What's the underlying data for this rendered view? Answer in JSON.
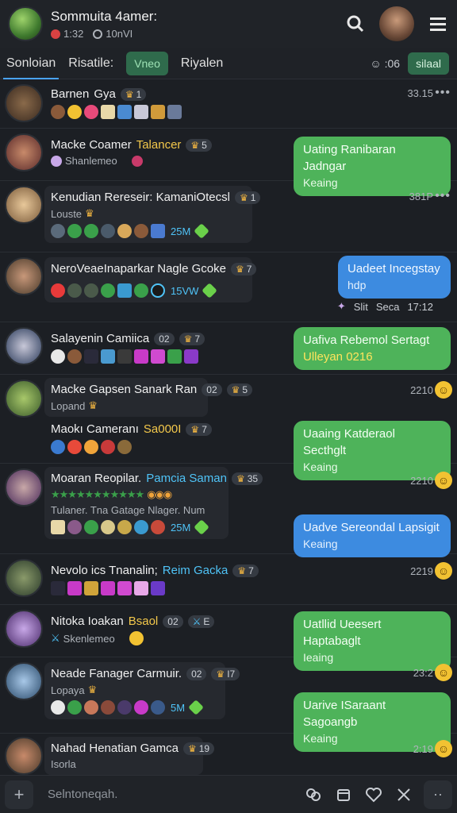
{
  "header": {
    "title": "Sommuita 4amer:",
    "status_count": "1:32",
    "status_time": "10nVI",
    "icons": [
      "search-icon",
      "user-avatar",
      "menu-icon"
    ]
  },
  "tabs": {
    "items": [
      "Sonloian",
      "Risatile:",
      "Vneo",
      "Riyalen"
    ],
    "counter": ":06",
    "action": "silaal"
  },
  "chats": [
    {
      "name": "Barnen",
      "name2": "Gya",
      "badge": "1",
      "time": "33.15",
      "dots": "•••"
    },
    {
      "name": "Macke Coamer",
      "name_hl": "Talancer",
      "badge": "5",
      "sub": "Shanlemeo",
      "reply": "Uating Ranibaran Jadngar",
      "reply_sub": "Keaing"
    },
    {
      "name": "Kenudian Rereseir: KamaniOtecsl",
      "badge": "1",
      "sub": "Louste",
      "stat": "25M",
      "time": "381P",
      "dots": "•••"
    },
    {
      "name": "NeroVeaeInaparkar Nagle Gcoke",
      "badge": "7",
      "stat": "15VW",
      "reply": "Uadeet Incegstay",
      "reply_sub": "hdp",
      "meta1": "Slit",
      "meta2": "Seca",
      "meta3": "17:12"
    },
    {
      "name": "Salayenin Camiica",
      "badge_a": "02",
      "badge": "7",
      "reply": "Uafiva Rebemol Sertagt",
      "reply_y": "Ulleyan 0216"
    },
    {
      "name": "Macke Gapsen Sanark Ran",
      "badge_a": "02",
      "badge": "5",
      "sub": "Lopand",
      "name_b": "Maokı Cameranı",
      "name_b_hl": "Sa000I",
      "badge_b": "7",
      "reply": "Uaaing Katderaol Secthglt",
      "reply_sub": "Keaing",
      "time": "2210"
    },
    {
      "name": "Moaran Reopilar.",
      "name_bl": "Pamcia Saman",
      "badge": "35",
      "sub": "Tulaner. Tna Gatage Nlager. Num",
      "stat": "25M",
      "reply": "Uadve Sereondal Lapsigit",
      "reply_sub": "Keaing",
      "time": "2210"
    },
    {
      "name": "Nevolo ics Tnanalin;",
      "name_bl": "Reim Gacka",
      "badge": "7",
      "time": "2219"
    },
    {
      "name": "Nitoka Ioakan",
      "name_hl": "Bsaol",
      "badge_a": "02",
      "badge": "E",
      "sub": "Skenlemeo",
      "reply": "Uatllid Ueesert Haptabaglt",
      "reply_sub": "Ieaing"
    },
    {
      "name": "Neade Fanager Carmuir.",
      "badge_a": "02",
      "badge": "I7",
      "sub": "Lopaya",
      "stat": "5M",
      "reply": "Uarive ISaraant Sagoangb",
      "reply_sub": "Keaing",
      "time": "23:2"
    },
    {
      "name": "Nahad Henatian Gamca",
      "badge": "19",
      "sub": "Isorla",
      "time": "2:19"
    }
  ],
  "composer": {
    "placeholder": "Selntoneqah."
  },
  "colors": {
    "accent": "#4eb35a",
    "blue": "#3d8be0",
    "gold": "#f3c84b"
  }
}
